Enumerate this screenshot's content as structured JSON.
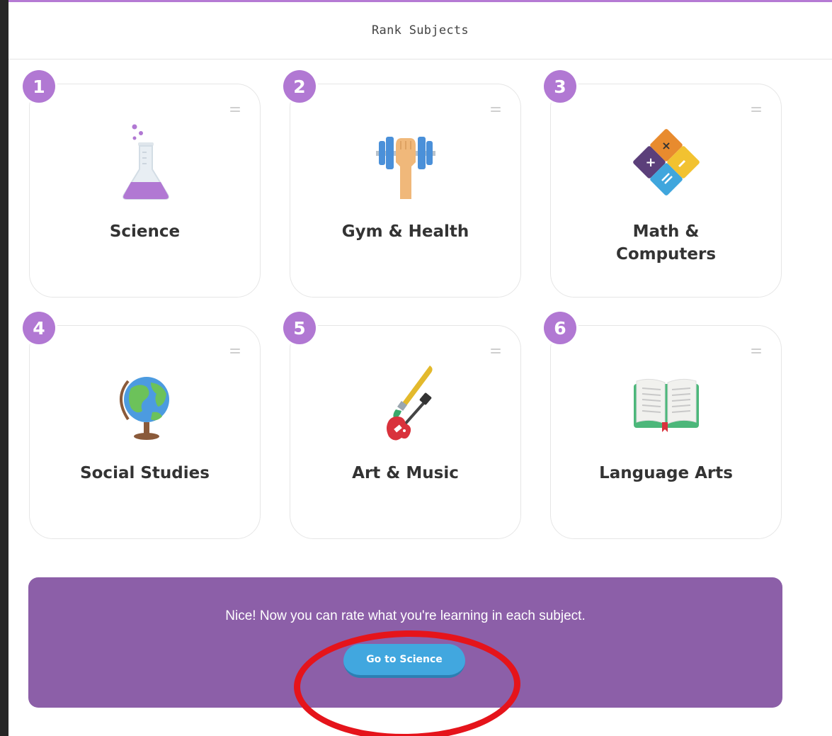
{
  "header": {
    "title": "Rank Subjects"
  },
  "cards": [
    {
      "rank": "1",
      "label": "Science",
      "icon": "flask-icon"
    },
    {
      "rank": "2",
      "label": "Gym & Health",
      "icon": "dumbbell-icon"
    },
    {
      "rank": "3",
      "label": "Math & Computers",
      "icon": "calculator-diamond-icon"
    },
    {
      "rank": "4",
      "label": "Social Studies",
      "icon": "globe-icon"
    },
    {
      "rank": "5",
      "label": "Art & Music",
      "icon": "paintbrush-guitar-icon"
    },
    {
      "rank": "6",
      "label": "Language Arts",
      "icon": "open-book-icon"
    }
  ],
  "banner": {
    "message": "Nice! Now you can rate what you're learning in each subject.",
    "button_label": "Go to Science"
  },
  "colors": {
    "badge": "#b178d3",
    "banner": "#8c5fa8",
    "button": "#41a7df",
    "annotation": "#e5141b"
  }
}
